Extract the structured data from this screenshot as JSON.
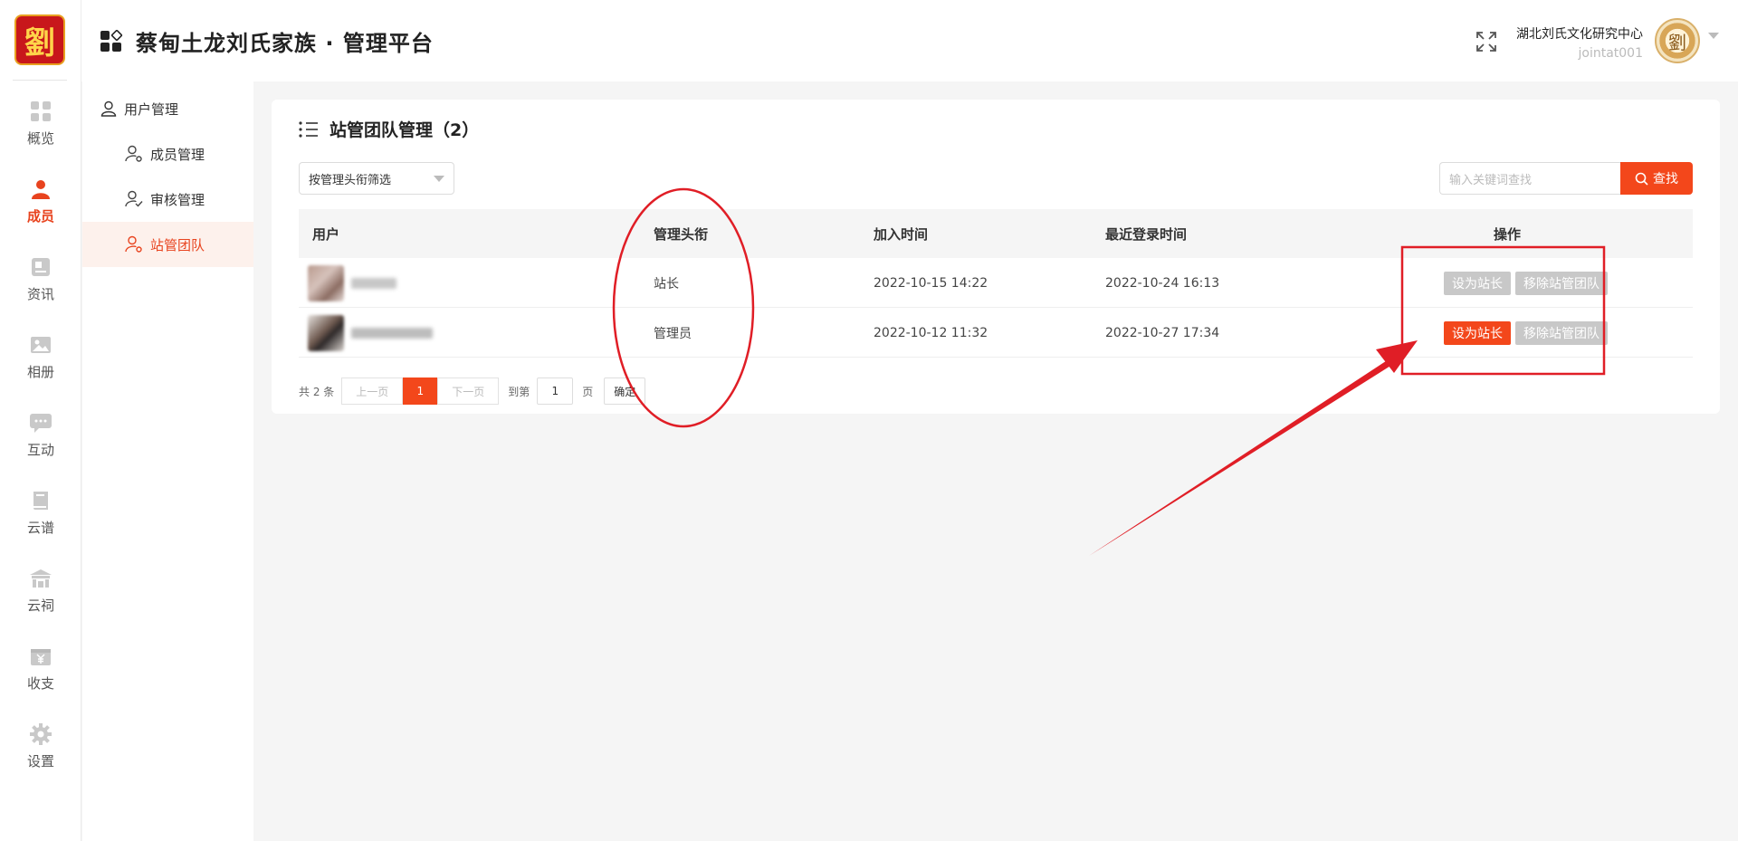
{
  "app": {
    "logo_char": "劉",
    "title": "蔡甸土龙刘氏家族 · 管理平台"
  },
  "rail": [
    {
      "label": "概览",
      "icon": "grid-icon"
    },
    {
      "label": "成员",
      "icon": "person-icon"
    },
    {
      "label": "资讯",
      "icon": "news-icon"
    },
    {
      "label": "相册",
      "icon": "image-icon"
    },
    {
      "label": "互动",
      "icon": "chat-icon"
    },
    {
      "label": "云谱",
      "icon": "book-icon"
    },
    {
      "label": "云祠",
      "icon": "temple-icon"
    },
    {
      "label": "收支",
      "icon": "yen-icon"
    },
    {
      "label": "设置",
      "icon": "gear-icon"
    }
  ],
  "header": {
    "org_name": "湖北刘氏文化研究中心",
    "user_id": "jointat001",
    "avatar_char": "劉"
  },
  "subnav": {
    "group": "用户管理",
    "items": [
      {
        "label": "成员管理",
        "active": false
      },
      {
        "label": "审核管理",
        "active": false
      },
      {
        "label": "站管团队",
        "active": true
      }
    ]
  },
  "page": {
    "title": "站管团队管理（2）",
    "filter_label": "按管理头衔筛选",
    "search_placeholder": "输入关键词查找",
    "search_button": "查找"
  },
  "table": {
    "headers": [
      "用户",
      "管理头衔",
      "加入时间",
      "最近登录时间",
      "操作"
    ],
    "rows": [
      {
        "title": "站长",
        "joined": "2022-10-15 14:22",
        "last_login": "2022-10-24 16:13",
        "btn_primary": "设为站长",
        "btn_remove": "移除站管团队",
        "primary_enabled": false
      },
      {
        "title": "管理员",
        "joined": "2022-10-12 11:32",
        "last_login": "2022-10-27 17:34",
        "btn_primary": "设为站长",
        "btn_remove": "移除站管团队",
        "primary_enabled": true
      }
    ]
  },
  "pager": {
    "total": "共 2 条",
    "prev": "上一页",
    "current": "1",
    "next": "下一页",
    "goto": "到第",
    "page_input": "1",
    "page_unit": "页",
    "confirm": "确定"
  },
  "colors": {
    "accent": "#f3471b",
    "annotation": "#e01e26"
  }
}
